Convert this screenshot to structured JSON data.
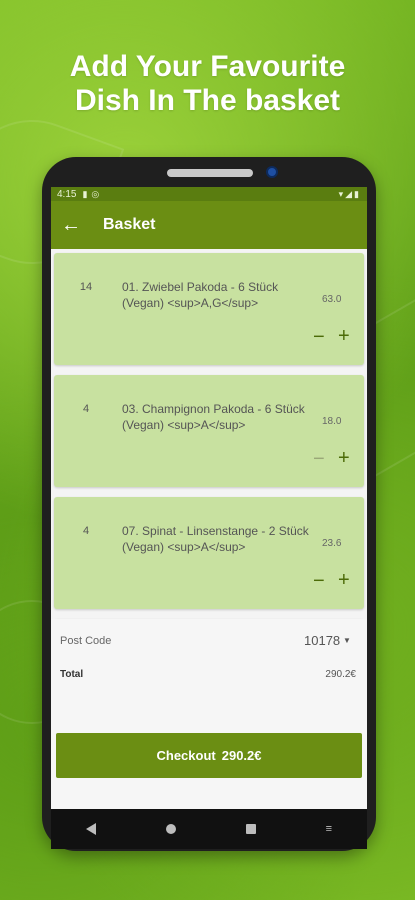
{
  "promo": {
    "line1": "Add Your Favourite",
    "line2": "Dish In The basket"
  },
  "status_bar": {
    "time": "4:15",
    "left_icons": [
      "battery-icon",
      "data-saver-icon"
    ],
    "right_icons": [
      "wifi-icon",
      "signal-icon",
      "battery-icon"
    ]
  },
  "app_bar": {
    "title": "Basket",
    "back_icon": "arrow-left-icon"
  },
  "items": [
    {
      "qty": "14",
      "name": "01. Zwiebel Pakoda - 6 Stück (Vegan) <sup>A,G</sup>",
      "price": "63.0",
      "minus_disabled": false
    },
    {
      "qty": "4",
      "name": "03. Champignon Pakoda - 6 Stück (Vegan) <sup>A</sup>",
      "price": "18.0",
      "minus_disabled": true
    },
    {
      "qty": "4",
      "name": "07. Spinat - Linsenstange - 2 Stück (Vegan) <sup>A</sup>",
      "price": "23.6",
      "minus_disabled": false
    }
  ],
  "controls": {
    "minus": "−",
    "plus": "+"
  },
  "summary": {
    "post_code_label": "Post Code",
    "post_code_value": "10178",
    "caret": "▼",
    "total_label": "Total",
    "total_value": "290.2€"
  },
  "checkout": {
    "label": "Checkout",
    "amount": "290.2€"
  },
  "colors": {
    "app_bar": "#6b8e13",
    "card": "#c8e1a0",
    "accent_dark": "#4c6b08"
  }
}
